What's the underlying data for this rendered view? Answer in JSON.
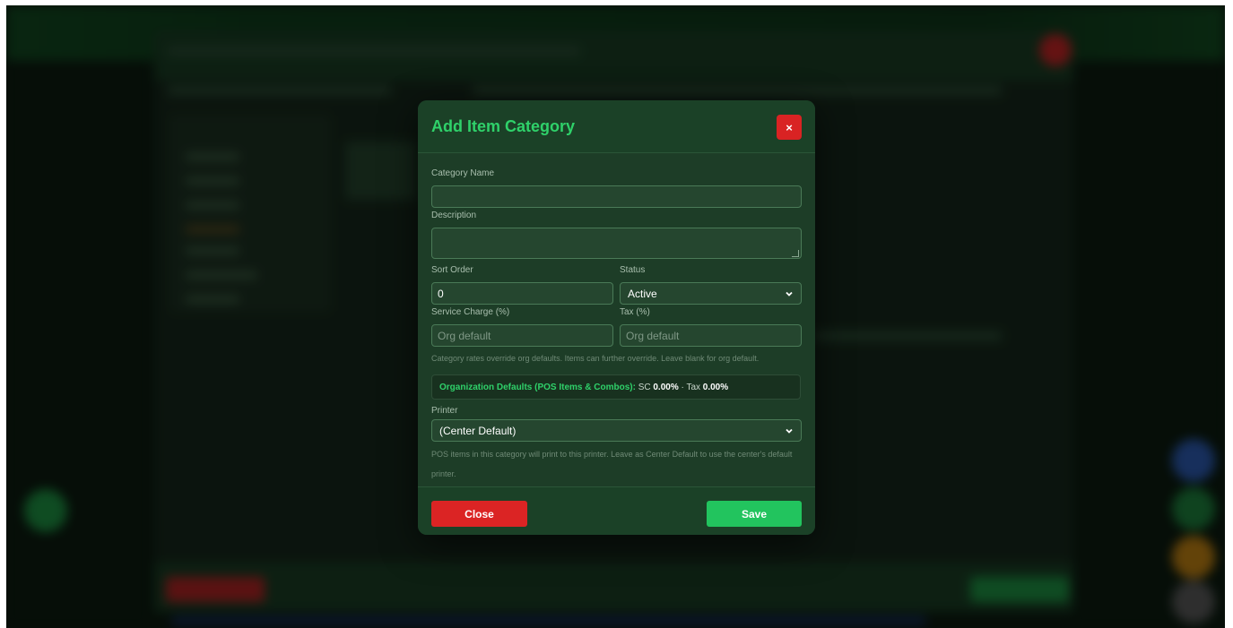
{
  "modal": {
    "title": "Add Item Category",
    "close_icon_glyph": "×",
    "fields": {
      "category_name": {
        "label": "Category Name",
        "value": "",
        "placeholder": ""
      },
      "description": {
        "label": "Description",
        "value": "",
        "placeholder": ""
      },
      "sort_order": {
        "label": "Sort Order",
        "value": "0"
      },
      "status": {
        "label": "Status",
        "selected": "Active"
      },
      "service_charge": {
        "label": "Service Charge (%)",
        "value": "",
        "placeholder": "Org default"
      },
      "tax": {
        "label": "Tax (%)",
        "value": "",
        "placeholder": "Org default"
      },
      "printer": {
        "label": "Printer",
        "selected": "(Center Default)"
      }
    },
    "rates_help": "Category rates override org defaults. Items can further override. Leave blank for org default.",
    "org_defaults": {
      "heading": "Organization Defaults (POS Items & Combos):",
      "sc_label": " SC ",
      "sc_value": "0.00%",
      "separator": " · Tax ",
      "tax_value": "0.00%"
    },
    "printer_help_line1": "POS items in this category will print to this printer. Leave as Center Default to use the center's default",
    "printer_help_line2": "printer.",
    "buttons": {
      "close": "Close",
      "save": "Save"
    }
  },
  "colors": {
    "accent_green": "#2fd16a",
    "danger_red": "#db2424",
    "save_green": "#22c45e",
    "modal_bg": "#1d3d27"
  }
}
